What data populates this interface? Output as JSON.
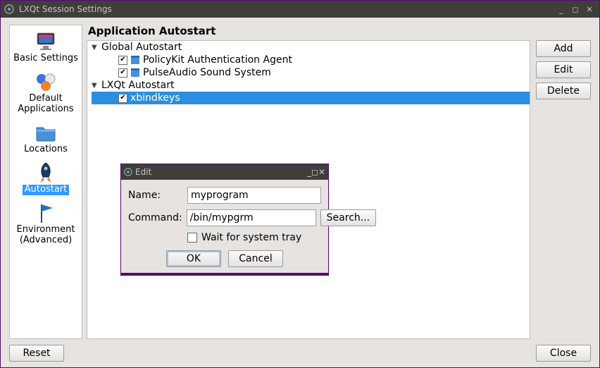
{
  "window": {
    "title": "LXQt Session Settings"
  },
  "sidebar": {
    "items": [
      {
        "label": "Basic Settings",
        "icon": "monitor-icon"
      },
      {
        "label": "Default Applications",
        "icon": "apps-icon"
      },
      {
        "label": "Locations",
        "icon": "folder-icon"
      },
      {
        "label": "Autostart",
        "icon": "rocket-icon",
        "selected": true
      },
      {
        "label": "Environment (Advanced)",
        "icon": "flag-icon"
      }
    ]
  },
  "page": {
    "title": "Application Autostart"
  },
  "tree": {
    "groups": [
      {
        "label": "Global Autostart",
        "expanded": true,
        "items": [
          {
            "label": "PolicyKit Authentication Agent",
            "checked": true,
            "icon": "window-icon"
          },
          {
            "label": "PulseAudio Sound System",
            "checked": true,
            "icon": "window-icon"
          }
        ]
      },
      {
        "label": "LXQt Autostart",
        "expanded": true,
        "items": [
          {
            "label": "xbindkeys",
            "checked": true,
            "selected": true
          }
        ]
      }
    ]
  },
  "buttons": {
    "add": "Add",
    "edit": "Edit",
    "delete": "Delete",
    "reset": "Reset",
    "close": "Close"
  },
  "dialog": {
    "title": "Edit",
    "name_label": "Name:",
    "name_value": "myprogram",
    "command_label": "Command:",
    "command_value": "/bin/mypgrm",
    "search_label": "Search...",
    "wait_label": "Wait for system tray",
    "wait_checked": false,
    "ok": "OK",
    "cancel": "Cancel"
  }
}
